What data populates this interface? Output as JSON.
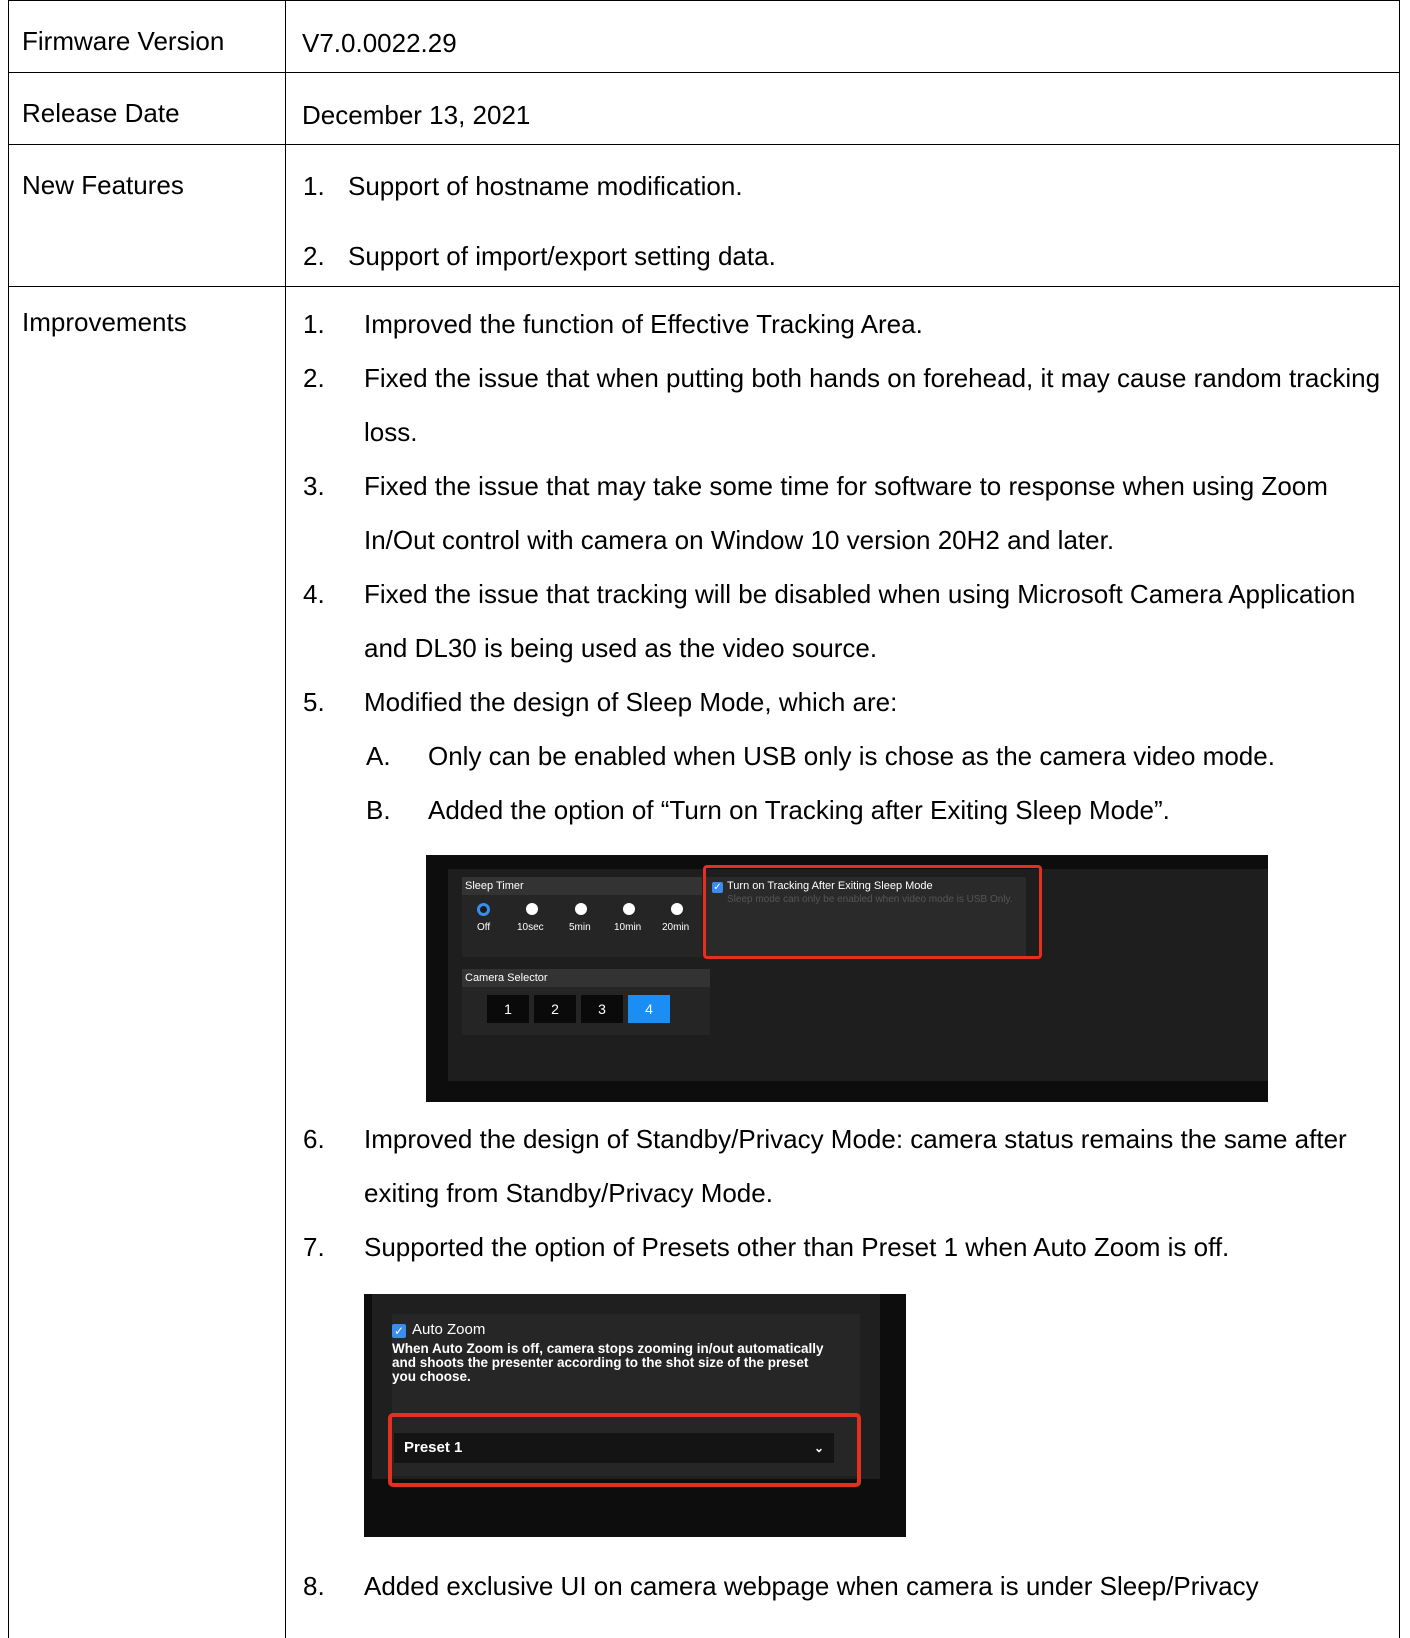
{
  "rows": {
    "firmware": {
      "label": "Firmware Version",
      "value": "V7.0.0022.29"
    },
    "release": {
      "label": "Release Date",
      "value": "December 13, 2021"
    },
    "features": {
      "label": "New Features",
      "items": [
        {
          "num": "1.",
          "text": "Support of hostname modification."
        },
        {
          "num": "2.",
          "text": "Support of import/export setting data."
        }
      ]
    },
    "improvements": {
      "label": "Improvements",
      "items": [
        {
          "num": "1.",
          "text": "Improved the function of Effective Tracking Area."
        },
        {
          "num": "2.",
          "text": "Fixed the issue that when putting both hands on forehead, it may cause random tracking loss."
        },
        {
          "num": "3.",
          "text": "Fixed the issue that may take some time for software to response when using Zoom In/Out control with camera on Window 10 version 20H2 and later."
        },
        {
          "num": "4.",
          "text": "Fixed the issue that tracking will be disabled when using Microsoft Camera Application and DL30 is being used as the video source."
        },
        {
          "num": "5.",
          "text": "Modified the design of Sleep Mode, which are:"
        },
        {
          "num": "6.",
          "text": "Improved the design of Standby/Privacy Mode: camera status remains the same after exiting from Standby/Privacy Mode."
        },
        {
          "num": "7.",
          "text": "Supported the option of Presets other than Preset 1 when Auto Zoom is off."
        },
        {
          "num": "8.",
          "text": "Added exclusive UI on camera webpage when camera is under Sleep/Privacy"
        }
      ],
      "subitems": [
        {
          "num": "A.",
          "text": "Only can be enabled when USB only is chose as the camera video mode."
        },
        {
          "num": "B.",
          "text": "Added the option of “Turn on Tracking after Exiting Sleep Mode”."
        }
      ]
    }
  },
  "screenshot1": {
    "sleep_timer": "Sleep Timer",
    "options": [
      "Off",
      "10sec",
      "5min",
      "10min",
      "20min"
    ],
    "tracking_label": "Turn on Tracking After Exiting Sleep Mode",
    "tracking_note": "Sleep mode can only be enabled when video mode is USB Only.",
    "camera_selector": "Camera Selector",
    "cameras": [
      "1",
      "2",
      "3",
      "4"
    ],
    "highlight_color": "#e53020",
    "accent_color": "#1a8ef5"
  },
  "screenshot2": {
    "auto_zoom_label": "Auto Zoom",
    "auto_zoom_desc": "When Auto Zoom is off, camera stops zooming in/out automatically and shoots the presenter according to the shot size of the preset you choose.",
    "preset_value": "Preset 1",
    "caret_icon": "chevron-down-icon"
  }
}
